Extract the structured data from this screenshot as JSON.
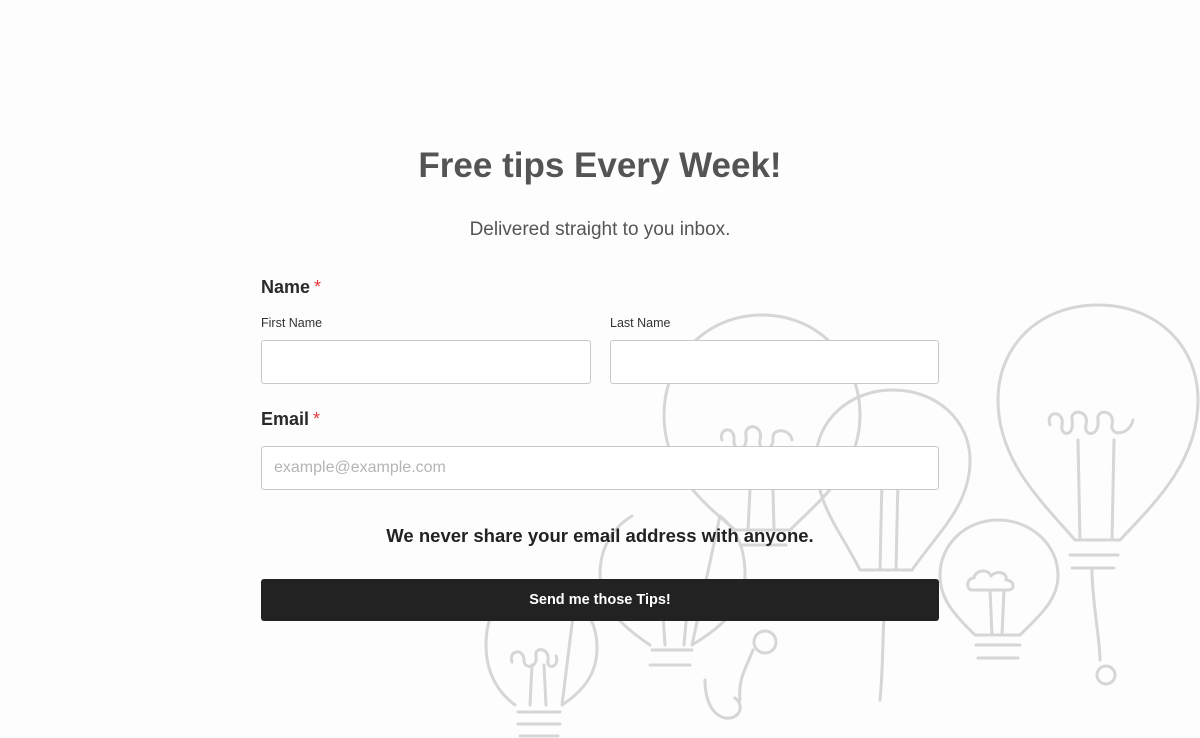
{
  "form": {
    "title": "Free tips Every Week!",
    "subtitle": "Delivered straight to you inbox.",
    "name_label": "Name",
    "required_mark": "*",
    "first_name_label": "First Name",
    "first_name_value": "",
    "last_name_label": "Last Name",
    "last_name_value": "",
    "email_label": "Email",
    "email_placeholder": "example@example.com",
    "email_value": "",
    "privacy_note": "We never share your email address with anyone.",
    "submit_label": "Send me those Tips!"
  },
  "background": {
    "illustration": "lightbulb-doodles"
  },
  "colors": {
    "button_bg": "#222222",
    "required_mark": "#e0393e",
    "title": "#545454",
    "doodle_stroke": "#d6d6d6"
  }
}
